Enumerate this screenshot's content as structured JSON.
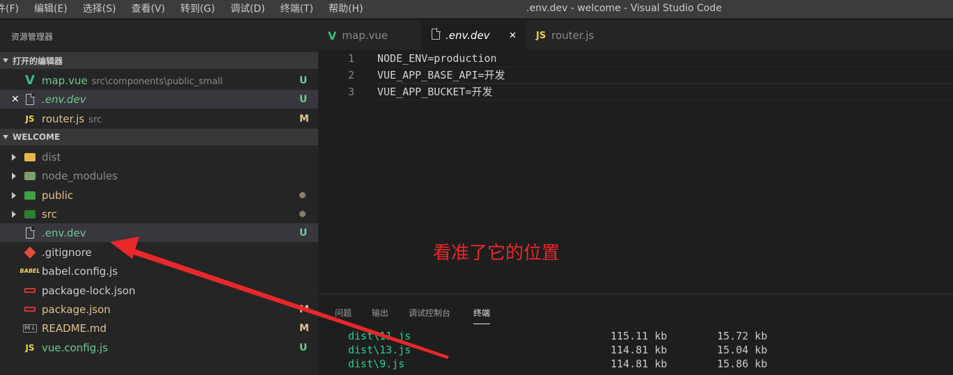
{
  "window": {
    "title": ".env.dev - welcome - Visual Studio Code"
  },
  "menu": [
    "件(F)",
    "编辑(E)",
    "选择(S)",
    "查看(V)",
    "转到(G)",
    "调试(D)",
    "终端(T)",
    "帮助(H)"
  ],
  "sidebar": {
    "title": "资源管理器",
    "open_editors": {
      "header": "打开的编辑器",
      "items": [
        {
          "icon": "vue-icon",
          "name": "map.vue",
          "desc": "src\\components\\public_small",
          "badge": "U"
        },
        {
          "icon": "file-icon",
          "name": ".env.dev",
          "desc": "",
          "badge": "U"
        },
        {
          "icon": "js-icon",
          "name": "router.js",
          "desc": "src",
          "badge": "M"
        }
      ]
    },
    "workspace": {
      "header": "WELCOME",
      "items": [
        {
          "name": "dist",
          "type": "folder"
        },
        {
          "name": "node_modules",
          "type": "folder"
        },
        {
          "name": "public",
          "type": "folder"
        },
        {
          "name": "src",
          "type": "folder"
        },
        {
          "name": ".env.dev",
          "type": "file",
          "badge": "U"
        },
        {
          "name": ".gitignore",
          "type": "file"
        },
        {
          "name": "babel.config.js",
          "type": "file"
        },
        {
          "name": "package-lock.json",
          "type": "file"
        },
        {
          "name": "package.json",
          "type": "file",
          "badge": "M"
        },
        {
          "name": "README.md",
          "type": "file",
          "badge": "M"
        },
        {
          "name": "vue.config.js",
          "type": "file",
          "badge": "U"
        }
      ]
    }
  },
  "tabs": [
    {
      "label": "map.vue",
      "icon": "vue-icon"
    },
    {
      "label": ".env.dev",
      "icon": "file-icon",
      "active": true
    },
    {
      "label": "router.js",
      "icon": "js-icon"
    }
  ],
  "tab_icons": {
    "js": "JS"
  },
  "editor": {
    "lines": [
      {
        "num": "1",
        "text": "NODE_ENV=production"
      },
      {
        "num": "2",
        "text": "VUE_APP_BASE_API=开发"
      },
      {
        "num": "3",
        "text": "VUE_APP_BUCKET=开发"
      }
    ]
  },
  "annotation": "看准了它的位置",
  "panel": {
    "tabs": [
      "问题",
      "输出",
      "调试控制台",
      "终端"
    ],
    "active_tab": "终端",
    "terminal": [
      {
        "file": "dist\\11.js",
        "size": "115.11 kb",
        "gzip": "15.72 kb"
      },
      {
        "file": "dist\\13.js",
        "size": "114.81 kb",
        "gzip": "15.04 kb"
      },
      {
        "file": "dist\\9.js",
        "size": "114.81 kb",
        "gzip": "15.86 kb"
      }
    ]
  },
  "colors": {
    "untracked": "#73c991",
    "modified": "#e2c08d",
    "annotation": "#e8282a",
    "terminal_file": "#23d18b"
  }
}
